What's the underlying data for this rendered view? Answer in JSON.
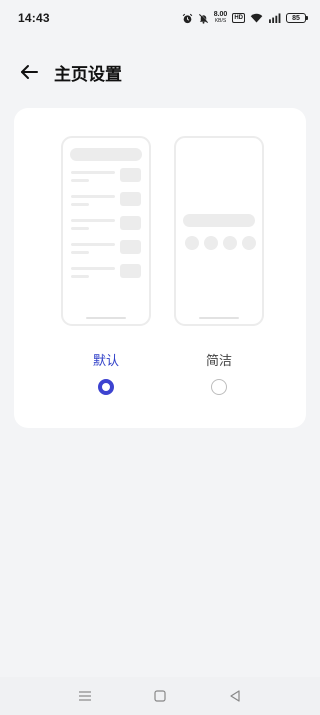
{
  "status_bar": {
    "time": "14:43",
    "net_speed_value": "8.00",
    "net_speed_unit": "KB/S",
    "hd_label": "HD",
    "battery_level": "85",
    "icons": [
      "alarm-icon",
      "mute-icon",
      "wifi-icon",
      "signal-icon",
      "battery-icon"
    ]
  },
  "header": {
    "back_icon": "arrow-left-icon",
    "title": "主页设置"
  },
  "options": [
    {
      "label": "默认",
      "selected": true,
      "preview": "list-layout"
    },
    {
      "label": "简洁",
      "selected": false,
      "preview": "simple-layout"
    }
  ],
  "colors": {
    "accent": "#3d43d0",
    "selected_label": "#2f3fc8",
    "background": "#f3f4f6",
    "card": "#ffffff",
    "placeholder": "#ececec"
  },
  "nav_bar": {
    "icons": [
      "menu-icon",
      "home-square-icon",
      "back-triangle-icon"
    ]
  }
}
